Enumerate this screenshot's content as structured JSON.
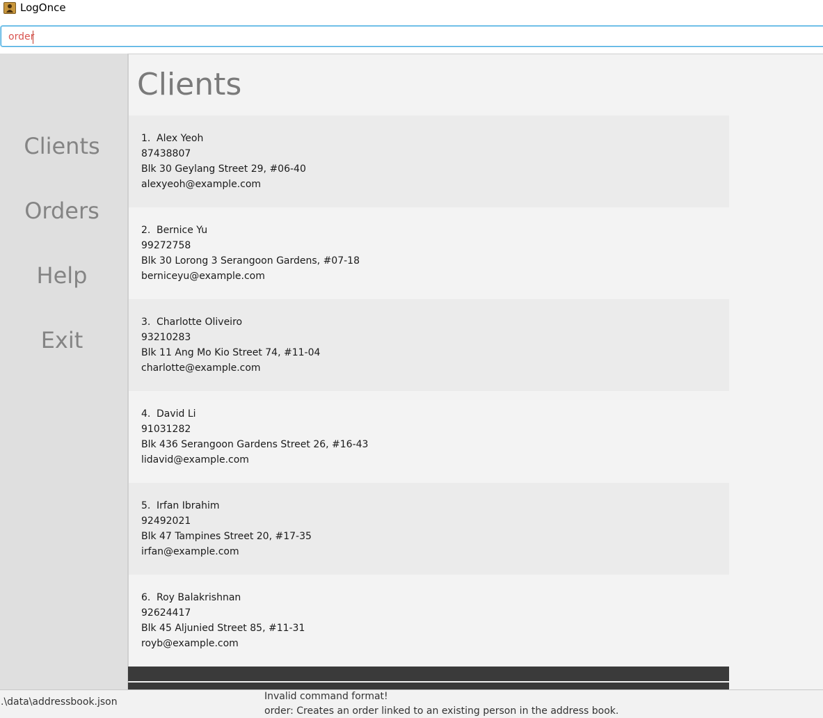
{
  "window": {
    "title": "LogOnce",
    "icon": "address-book-icon"
  },
  "command_box": {
    "value": "order"
  },
  "sidebar": {
    "items": [
      {
        "label": "Clients"
      },
      {
        "label": "Orders"
      },
      {
        "label": "Help"
      },
      {
        "label": "Exit"
      }
    ]
  },
  "main": {
    "title": "Clients",
    "clients": [
      {
        "index": "1.",
        "name": "Alex Yeoh",
        "phone": "87438807",
        "address": "Blk 30 Geylang Street 29, #06-40",
        "email": "alexyeoh@example.com"
      },
      {
        "index": "2.",
        "name": "Bernice Yu",
        "phone": "99272758",
        "address": "Blk 30 Lorong 3 Serangoon Gardens, #07-18",
        "email": "berniceyu@example.com"
      },
      {
        "index": "3.",
        "name": "Charlotte Oliveiro",
        "phone": "93210283",
        "address": "Blk 11 Ang Mo Kio Street 74, #11-04",
        "email": "charlotte@example.com"
      },
      {
        "index": "4.",
        "name": "David Li",
        "phone": "91031282",
        "address": "Blk 436 Serangoon Gardens Street 26, #16-43",
        "email": "lidavid@example.com"
      },
      {
        "index": "5.",
        "name": "Irfan Ibrahim",
        "phone": "92492021",
        "address": "Blk 47 Tampines Street 20, #17-35",
        "email": "irfan@example.com"
      },
      {
        "index": "6.",
        "name": "Roy Balakrishnan",
        "phone": "92624417",
        "address": "Blk 45 Aljunied Street 85, #11-31",
        "email": "royb@example.com"
      }
    ]
  },
  "status_bar": {
    "file_path": ".\\data\\addressbook.json"
  },
  "result_display": {
    "line1": "Invalid command format!",
    "line2": "order: Creates an order linked to an existing person in the address book."
  },
  "colors": {
    "command_text": "#d9534f",
    "focus_border": "#39a6e0",
    "nav_text": "#848484",
    "dark_bar": "#3a3a3a"
  }
}
